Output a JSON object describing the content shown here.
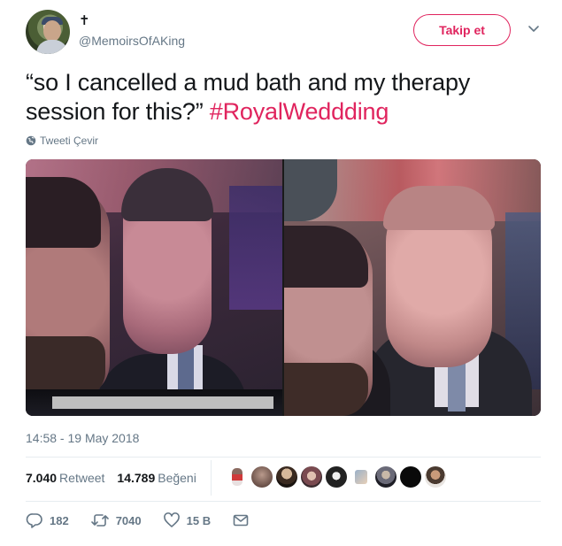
{
  "user": {
    "display_name": "✝",
    "handle": "@MemoirsOfAKing"
  },
  "follow_button": {
    "label": "Takip et"
  },
  "tweet": {
    "text_before": "“so I cancelled a mud bath and my therapy session for this?” ",
    "hashtag": "#RoyalWeddding"
  },
  "translate": {
    "label": "Tweeti Çevir"
  },
  "timestamp": "14:58 - 19 May 2018",
  "stats": {
    "retweets_count": "7.040",
    "retweets_label": "Retweet",
    "likes_count": "14.789",
    "likes_label": "Beğeni"
  },
  "actions": {
    "replies": "182",
    "retweets": "7040",
    "likes": "15 B"
  },
  "colors": {
    "accent": "#e0245e",
    "secondary_text": "#657786",
    "divider": "#e6ecf0"
  },
  "icons": [
    "chevron-down-icon",
    "globe-icon",
    "reply-icon",
    "retweet-icon",
    "heart-icon",
    "message-icon"
  ]
}
